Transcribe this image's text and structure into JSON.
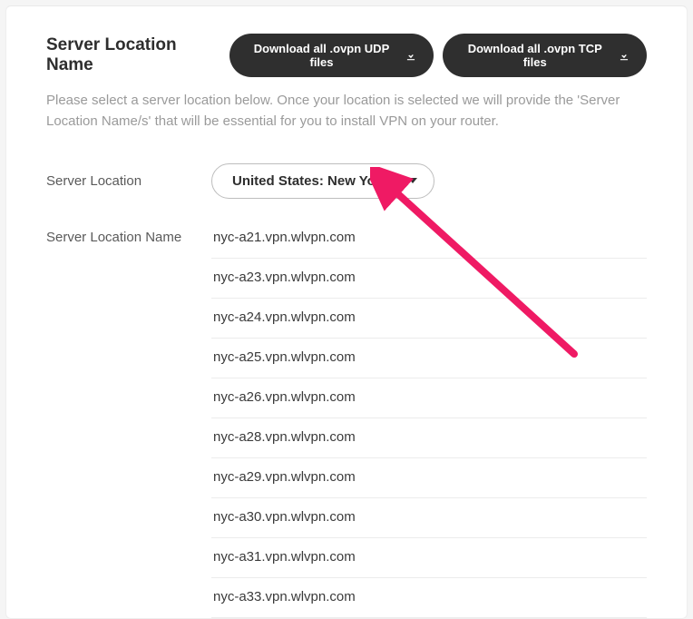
{
  "header": {
    "title": "Server Location Name",
    "buttons": {
      "udp": "Download all .ovpn UDP files",
      "tcp": "Download all .ovpn TCP files"
    }
  },
  "description": "Please select a server location below. Once your location is selected we will provide the 'Server Location Name/s' that will be essential for you to install VPN on your router.",
  "form": {
    "location_label": "Server Location",
    "location_value": "United States: New York",
    "name_label": "Server Location Name"
  },
  "servers": [
    "nyc-a21.vpn.wlvpn.com",
    "nyc-a23.vpn.wlvpn.com",
    "nyc-a24.vpn.wlvpn.com",
    "nyc-a25.vpn.wlvpn.com",
    "nyc-a26.vpn.wlvpn.com",
    "nyc-a28.vpn.wlvpn.com",
    "nyc-a29.vpn.wlvpn.com",
    "nyc-a30.vpn.wlvpn.com",
    "nyc-a31.vpn.wlvpn.com",
    "nyc-a33.vpn.wlvpn.com"
  ],
  "colors": {
    "arrow": "#ef1a64"
  }
}
